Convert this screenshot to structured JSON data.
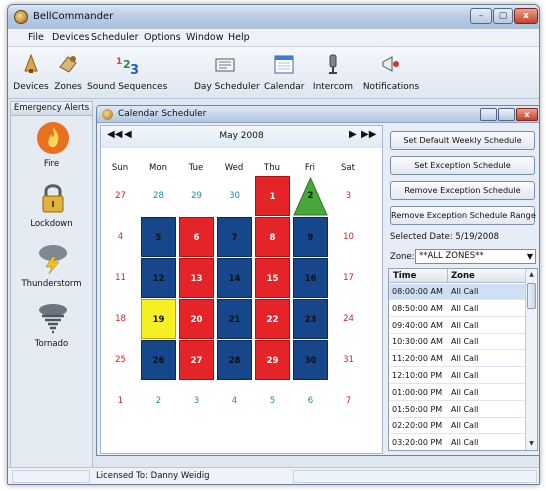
{
  "app": {
    "title": "BellCommander"
  },
  "window_controls": {
    "minimize": "–",
    "maximize": "▢",
    "close": "x"
  },
  "menu": [
    "File",
    "Devices",
    "Scheduler",
    "Options",
    "Window",
    "Help"
  ],
  "toolbar": [
    {
      "label": "Devices",
      "icon": "devices-icon"
    },
    {
      "label": "Zones",
      "icon": "zones-icon"
    },
    {
      "label": "Sound Sequences",
      "icon": "sound-sequences-icon"
    },
    {
      "label": "Day Scheduler",
      "icon": "day-scheduler-icon"
    },
    {
      "label": "Calendar",
      "icon": "calendar-icon"
    },
    {
      "label": "Intercom",
      "icon": "intercom-icon"
    },
    {
      "label": "Notifications",
      "icon": "notifications-icon"
    }
  ],
  "sidebar": {
    "title": "Emergency Alerts",
    "items": [
      {
        "label": "Fire",
        "icon": "fire-icon"
      },
      {
        "label": "Lockdown",
        "icon": "lock-icon"
      },
      {
        "label": "Thunderstorm",
        "icon": "thunderstorm-icon"
      },
      {
        "label": "Tornado",
        "icon": "tornado-icon"
      }
    ]
  },
  "calendar_window": {
    "title": "Calendar Scheduler",
    "nav": {
      "prev_year": "◀◀",
      "prev_month": "◀",
      "next_month": "▶",
      "next_year": "▶▶"
    },
    "month_label": "May 2008",
    "weekdays": [
      "Sun",
      "Mon",
      "Tue",
      "Wed",
      "Thu",
      "Fri",
      "Sat"
    ],
    "weeks": [
      [
        {
          "d": "27",
          "t": "plain"
        },
        {
          "d": "28",
          "t": "plain"
        },
        {
          "d": "29",
          "t": "plain"
        },
        {
          "d": "30",
          "t": "plain"
        },
        {
          "d": "1",
          "t": "red"
        },
        {
          "d": "2",
          "t": "green"
        },
        {
          "d": "3",
          "t": "plain"
        }
      ],
      [
        {
          "d": "4",
          "t": "plain"
        },
        {
          "d": "5",
          "t": "blue"
        },
        {
          "d": "6",
          "t": "red"
        },
        {
          "d": "7",
          "t": "blue"
        },
        {
          "d": "8",
          "t": "red"
        },
        {
          "d": "9",
          "t": "blue"
        },
        {
          "d": "10",
          "t": "plain"
        }
      ],
      [
        {
          "d": "11",
          "t": "plain"
        },
        {
          "d": "12",
          "t": "blue"
        },
        {
          "d": "13",
          "t": "red"
        },
        {
          "d": "14",
          "t": "blue"
        },
        {
          "d": "15",
          "t": "red"
        },
        {
          "d": "16",
          "t": "blue"
        },
        {
          "d": "17",
          "t": "plain"
        }
      ],
      [
        {
          "d": "18",
          "t": "plain"
        },
        {
          "d": "19",
          "t": "yellow"
        },
        {
          "d": "20",
          "t": "red"
        },
        {
          "d": "21",
          "t": "blue"
        },
        {
          "d": "22",
          "t": "red"
        },
        {
          "d": "23",
          "t": "blue"
        },
        {
          "d": "24",
          "t": "plain"
        }
      ],
      [
        {
          "d": "25",
          "t": "plain"
        },
        {
          "d": "26",
          "t": "blue"
        },
        {
          "d": "27",
          "t": "red"
        },
        {
          "d": "28",
          "t": "blue"
        },
        {
          "d": "29",
          "t": "red"
        },
        {
          "d": "30",
          "t": "blue"
        },
        {
          "d": "31",
          "t": "plain"
        }
      ],
      [
        {
          "d": "1",
          "t": "plain"
        },
        {
          "d": "2",
          "t": "plain"
        },
        {
          "d": "3",
          "t": "plain"
        },
        {
          "d": "4",
          "t": "plain"
        },
        {
          "d": "5",
          "t": "plain"
        },
        {
          "d": "6",
          "t": "plain"
        },
        {
          "d": "7",
          "t": "plain"
        }
      ]
    ],
    "colors": {
      "red": "#e42428",
      "blue": "#17468a",
      "yellow": "#f6ef24",
      "green": "#4aa63a"
    },
    "buttons": {
      "default_weekly": "Set Default Weekly Schedule",
      "exception": "Set Exception Schedule",
      "remove_exception": "Remove Exception Schedule",
      "remove_range": "Remove Exception Schedule Range"
    },
    "selected_date": "Selected Date: 5/19/2008",
    "zone_label": "Zone:",
    "zone_value": "**ALL ZONES**",
    "schedule": {
      "columns": [
        "Time",
        "Zone"
      ],
      "rows": [
        {
          "time": "08:00:00 AM",
          "zone": "All Call"
        },
        {
          "time": "08:50:00 AM",
          "zone": "All Call"
        },
        {
          "time": "09:40:00 AM",
          "zone": "All Call"
        },
        {
          "time": "10:30:00 AM",
          "zone": "All Call"
        },
        {
          "time": "11:20:00 AM",
          "zone": "All Call"
        },
        {
          "time": "12:10:00 PM",
          "zone": "All Call"
        },
        {
          "time": "01:00:00 PM",
          "zone": "All Call"
        },
        {
          "time": "01:50:00 PM",
          "zone": "All Call"
        },
        {
          "time": "02:20:00 PM",
          "zone": "All Call"
        },
        {
          "time": "03:20:00 PM",
          "zone": "All Call"
        }
      ]
    }
  },
  "status": {
    "license": "Licensed To: Danny Weidig"
  }
}
